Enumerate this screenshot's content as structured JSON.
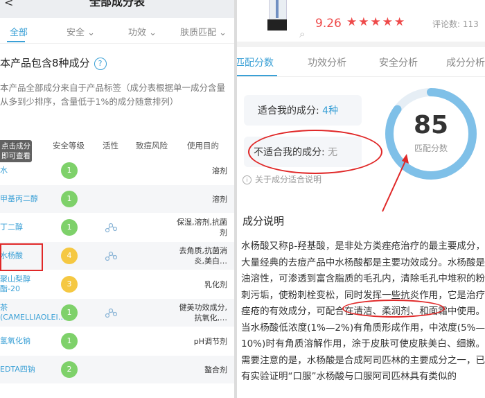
{
  "left": {
    "title": "全部成分表",
    "tabs": [
      "全部",
      "安全",
      "功效",
      "肤质匹配"
    ],
    "heading": "本产品包含8种成分",
    "description": "本产品全部成分来自于产品标签（成分表根据单一成分含量从多到少排序，含量低于1%的成分随意排列）",
    "tooltip": "点击成分即可查看",
    "columns": [
      "成分",
      "安全等级",
      "活性",
      "致痘风险",
      "使用目的"
    ],
    "rows": [
      {
        "name": "水",
        "safety": "1",
        "color": "#7ed16a",
        "active": false,
        "purpose": "溶剂"
      },
      {
        "name": "甲基丙二醇",
        "safety": "1",
        "color": "#7ed16a",
        "active": false,
        "purpose": "溶剂"
      },
      {
        "name": "丁二醇",
        "safety": "1",
        "color": "#7ed16a",
        "active": true,
        "purpose": "保湿,溶剂,抗菌剂"
      },
      {
        "name": "水杨酸",
        "safety": "4",
        "color": "#f5c842",
        "active": true,
        "purpose": "去角质,抗菌消炎,美白…"
      },
      {
        "name": "聚山梨醇酯-20",
        "safety": "3",
        "color": "#f5c842",
        "active": false,
        "purpose": "乳化剂"
      },
      {
        "name": "茶(CAMELLIAOLEI…",
        "safety": "1",
        "color": "#7ed16a",
        "active": true,
        "purpose": "健美功效成分,抗氧化,…"
      },
      {
        "name": "氢氧化钠",
        "safety": "1",
        "color": "#7ed16a",
        "active": false,
        "purpose": "pH调节剂"
      },
      {
        "name": "EDTA四钠",
        "safety": "2",
        "color": "#7ed16a",
        "active": false,
        "purpose": "螯合剂"
      }
    ]
  },
  "right": {
    "score": "9.26",
    "stars": "★★★★★",
    "comments": "评论数: 113",
    "tabs": [
      "匹配分数",
      "功效分析",
      "安全分析",
      "成分分析"
    ],
    "suit_label": "适合我的成分: ",
    "suit_count": "4种",
    "unsuit_label": "不适合我的成分: ",
    "unsuit_value": "无",
    "info_link": "关于成分适合说明",
    "gauge_value": "85",
    "gauge_fraction": 0.85,
    "gauge_label": "匹配分数",
    "section_title": "成分说明",
    "body": "水杨酸又称β-羟基酸，是非处方类痤疮治疗的最主要成分，大量经典的去痘产品中水杨酸都是主要功效成分。水杨酸是油溶性，可渗透到富含脂质的毛孔内，清除毛孔中堆积的粉刺污垢，使粉刺栓变松，同时发挥一些抗炎作用，它是治疗痤疮的有效成分，可配合在清洁、柔润剂、和面霜中使用。当水杨酸低浓度(1%—2%)有角质形成作用，中浓度(5%—10%)时有角质溶解作用，涂于皮肤可使皮肤美白、细嫩。需要注意的是，水杨酸是合成阿司匹林的主要成分之一，已有实验证明“口服”水杨酸与口服阿司匹林具有类似的"
  },
  "colors": {
    "accent": "#3aa0d6",
    "red": "#ee4a4a",
    "annotation": "#e02828",
    "green_badge": "#7ed16a",
    "yellow_badge": "#f5c842"
  }
}
